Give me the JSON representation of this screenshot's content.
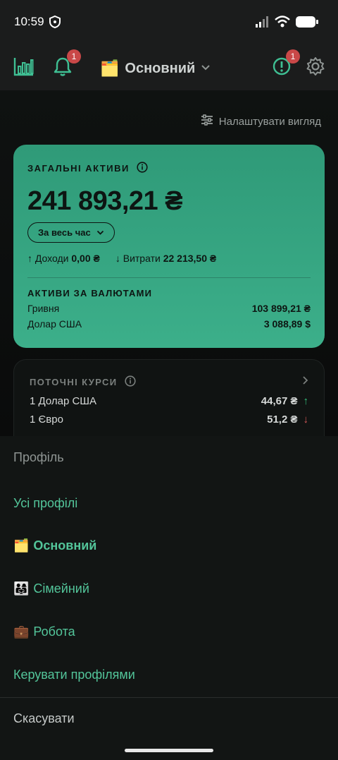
{
  "status": {
    "time": "10:59"
  },
  "appbar": {
    "notifications_badge": "1",
    "alerts_badge": "1",
    "profile_emoji": "🗂️",
    "profile_name": "Основний"
  },
  "main": {
    "customize_label": "Налаштувати вигляд",
    "assets": {
      "title": "ЗАГАЛЬНІ АКТИВИ",
      "total": "241 893,21 ₴",
      "period": "За весь час",
      "income_label": "↑ Доходи",
      "income_value": "0,00 ₴",
      "expense_label": "↓ Витрати",
      "expense_value": "22 213,50 ₴",
      "by_currency_title": "АКТИВИ ЗА ВАЛЮТАМИ",
      "currencies": [
        {
          "name": "Гривня",
          "amount": "103 899,21 ₴"
        },
        {
          "name": "Долар США",
          "amount": "3 088,89 $"
        }
      ]
    },
    "rates": {
      "title": "ПОТОЧНІ КУРСИ",
      "items": [
        {
          "name": "1 Долар США",
          "value": "44,67 ₴",
          "trend": "↑"
        },
        {
          "name": "1 Євро",
          "value": "51,2 ₴",
          "trend": "↓"
        }
      ]
    }
  },
  "sheet": {
    "header": "Профіль",
    "items": [
      {
        "emoji": "",
        "label": "Усі профілі"
      },
      {
        "emoji": "🗂️",
        "label": "Основний"
      },
      {
        "emoji": "👨‍👩‍👧",
        "label": "Сімейний"
      },
      {
        "emoji": "💼",
        "label": "Робота"
      },
      {
        "emoji": "",
        "label": "Керувати профілями"
      }
    ],
    "cancel": "Скасувати"
  },
  "colors": {
    "accent": "#53c59a",
    "card": "#35a582",
    "badge": "#c94848"
  }
}
